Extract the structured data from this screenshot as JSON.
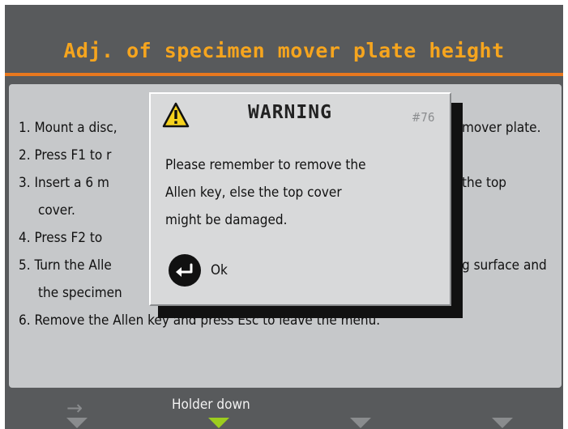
{
  "header": {
    "title": "Adj. of specimen mover plate height"
  },
  "instructions": [
    "1. Mount a disc,",
    "mover plate.",
    "2. Press F1 to r",
    "3. Insert a 6 m",
    "the top",
    "cover.",
    "4. Press F2 to",
    "5. Turn the Alle",
    "g surface and",
    "the specimen",
    "6. Remove the Allen key and press Esc to leave the menu."
  ],
  "dialog": {
    "icon": "warning-triangle-icon",
    "title": "WARNING",
    "code": "#76",
    "message_lines": [
      "Please remember to remove the",
      "Allen key, else the top cover",
      "might be damaged."
    ],
    "ok_icon": "enter-key-icon",
    "ok_label": "Ok"
  },
  "softkeys": {
    "f1_icon": "right-arrow-icon",
    "f2_label": "Holder down",
    "active_index": 1
  },
  "colors": {
    "background": "#585a5c",
    "title": "#f6a51e",
    "accent_line": "#e8781e",
    "panel": "#c6c8ca",
    "dialog": "#d8d9da",
    "softkey_active": "#9ccd1e",
    "softkey_inactive": "#8a8c8e"
  }
}
